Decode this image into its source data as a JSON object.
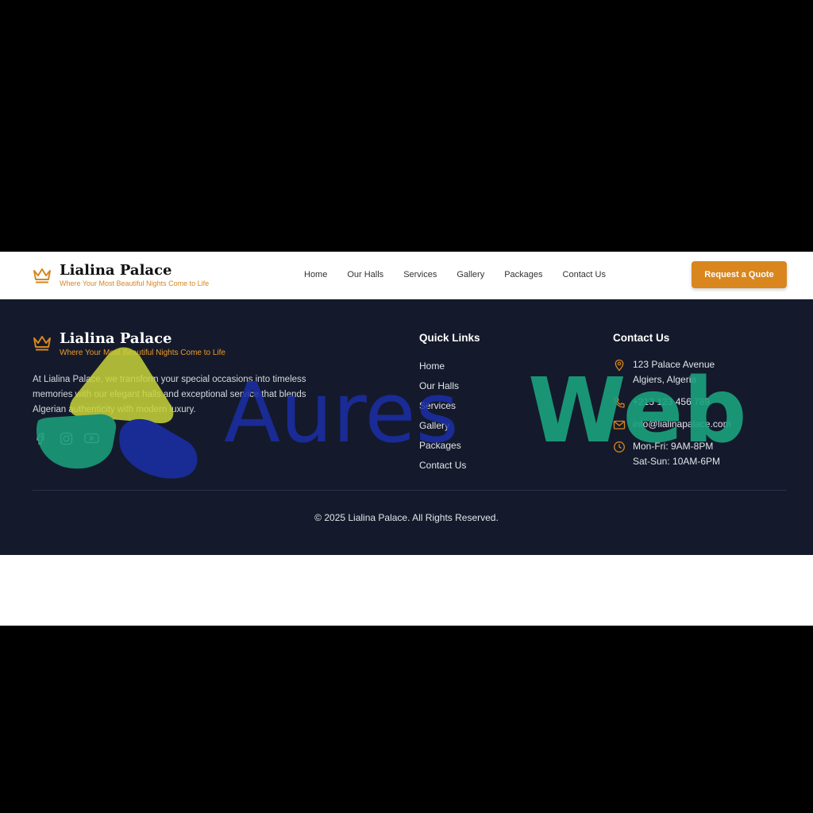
{
  "header": {
    "brand_title": "Lialina Palace",
    "brand_tagline": "Where Your Most Beautiful Nights Come to Life",
    "nav": [
      "Home",
      "Our Halls",
      "Services",
      "Gallery",
      "Packages",
      "Contact Us"
    ],
    "cta_label": "Request a Quote"
  },
  "footer": {
    "brand_title": "Lialina Palace",
    "brand_tagline": "Where Your Most Beautiful Nights Come to Life",
    "description": "At Lialina Palace, we transform your special occasions into timeless memories with our elegant halls and exceptional service that blends Algerian authenticity with modern luxury.",
    "socials": [
      "facebook-icon",
      "instagram-icon",
      "youtube-icon"
    ],
    "quick_links_title": "Quick Links",
    "quick_links": [
      "Home",
      "Our Halls",
      "Services",
      "Gallery",
      "Packages",
      "Contact Us"
    ],
    "contact_title": "Contact Us",
    "address_line1": "123 Palace Avenue",
    "address_line2": "Algiers, Algeria",
    "phone": "+213 123 456 789",
    "email": "info@lialinapalace.com",
    "hours_line1": "Mon-Fri: 9AM-8PM",
    "hours_line2": "Sat-Sun: 10AM-6PM",
    "copyright": "© 2025 Lialina Palace. All Rights Reserved."
  },
  "watermark": {
    "text_part1": "Aures",
    "text_part2": "Web"
  },
  "colors": {
    "accent": "#d9861e",
    "footer_bg": "#141a2b",
    "watermark_blue": "#1b2fa8",
    "watermark_green": "#1aa37e",
    "watermark_yellow": "#c8d43a"
  }
}
